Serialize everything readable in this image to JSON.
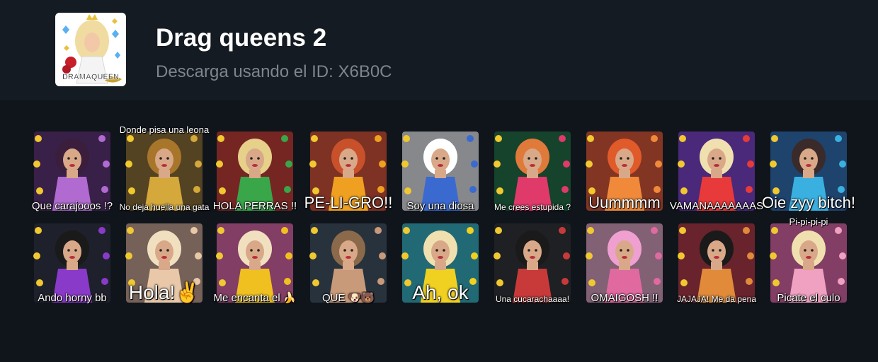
{
  "pack": {
    "title": "Drag queens 2",
    "subtitle": "Descarga usando el ID: X6B0C",
    "thumb_text": "DRAMAQUEEN"
  },
  "stickers": [
    {
      "caption": "Que carajooos !?",
      "top": "",
      "bg": "#5a2a6e",
      "accent": "#b06ad0",
      "hair": "#3a1e3c",
      "size": "normal"
    },
    {
      "caption": "No deja huella una gata",
      "top": "Donde pisa una leona",
      "bg": "#8a6a2a",
      "accent": "#d4a83a",
      "hair": "#a8762a",
      "size": "small"
    },
    {
      "caption": "HOLA PERRAS !!",
      "top": "",
      "bg": "#c8342a",
      "accent": "#3aa64a",
      "hair": "#e6d08a",
      "size": "normal"
    },
    {
      "caption": "PE-LI-GRO!!",
      "top": "",
      "bg": "#d84a2a",
      "accent": "#f0a020",
      "hair": "#c8502a",
      "size": "big"
    },
    {
      "caption": "Soy una diosa",
      "top": "",
      "bg": "#e8e8e8",
      "accent": "#3a6ad0",
      "hair": "#ffffff",
      "size": "normal"
    },
    {
      "caption": "Me crees estupida ?",
      "top": "",
      "bg": "#1a6a3a",
      "accent": "#e03a6a",
      "hair": "#e07a3a",
      "size": "small"
    },
    {
      "caption": "Uummmm",
      "top": "",
      "bg": "#e0502a",
      "accent": "#f08a3a",
      "hair": "#e05a2a",
      "size": "big"
    },
    {
      "caption": "VAMANAAAAAAAS",
      "top": "",
      "bg": "#7a3ac8",
      "accent": "#e83a3a",
      "hair": "#f0e0b0",
      "size": "normal"
    },
    {
      "caption": "Oie zyy bitch!",
      "top": "",
      "bg": "#2a6ab0",
      "accent": "#3ab0e0",
      "hair": "#3a2a2a",
      "size": "big"
    },
    {
      "caption": "Ando horny bb",
      "top": "",
      "bg": "#2a2a3a",
      "accent": "#8a3ac8",
      "hair": "#1a1a1a",
      "size": "normal"
    },
    {
      "caption": "Hola!✌",
      "top": "",
      "bg": "#c8a08a",
      "accent": "#e8c8a8",
      "hair": "#f0e0c0",
      "size": "xl"
    },
    {
      "caption": "Me encanta el 🍌",
      "top": "",
      "bg": "#e060a0",
      "accent": "#f0c020",
      "hair": "#f0e0c0",
      "size": "normal"
    },
    {
      "caption": "QUE 🐶🐻",
      "top": "",
      "bg": "#3a4a5a",
      "accent": "#c89a7a",
      "hair": "#8a6a4a",
      "size": "normal"
    },
    {
      "caption": "Ah, ok",
      "top": "",
      "bg": "#30b0c0",
      "accent": "#f0d020",
      "hair": "#f0e0b0",
      "size": "xl"
    },
    {
      "caption": "Una cucarachaaaa!",
      "top": "",
      "bg": "#2a2a2a",
      "accent": "#c83a3a",
      "hair": "#1a1a1a",
      "size": "small"
    },
    {
      "caption": "OMAIGOSH !!",
      "top": "",
      "bg": "#e0a0c0",
      "accent": "#e06aa0",
      "hair": "#f0a0d0",
      "size": "normal"
    },
    {
      "caption": "JAJAJA! Me da pena",
      "top": "",
      "bg": "#b0303a",
      "accent": "#e08a3a",
      "hair": "#1a1a1a",
      "size": "small"
    },
    {
      "caption": "Picate el culo",
      "top": "Pi-pi-pi-pi",
      "bg": "#e060a0",
      "accent": "#f0a0c0",
      "hair": "#f0e0b0",
      "size": "normal"
    }
  ],
  "colors": {
    "background": "#10151b",
    "header": "#151b22",
    "title": "#ffffff",
    "subtitle": "#7d858d"
  }
}
